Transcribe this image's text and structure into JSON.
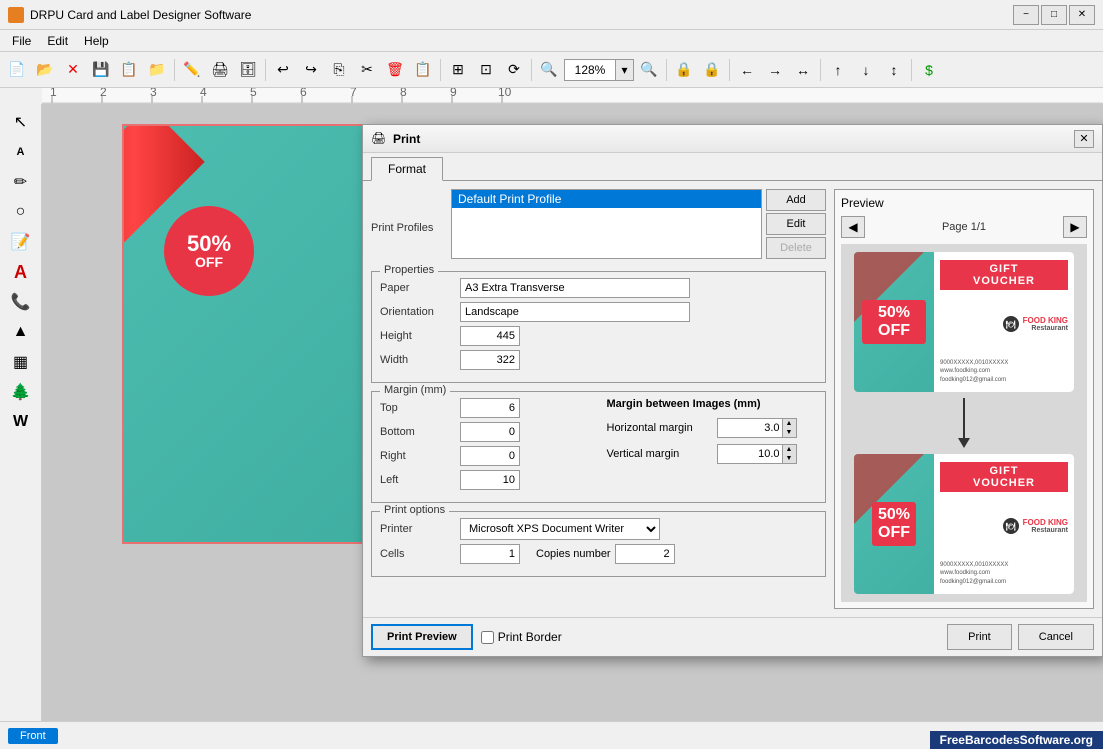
{
  "app": {
    "title": "DRPU Card and Label Designer Software",
    "icon": "🖨"
  },
  "titlebar": {
    "minimize": "−",
    "maximize": "□",
    "close": "✕"
  },
  "menu": {
    "items": [
      "File",
      "Edit",
      "Help"
    ]
  },
  "toolbar": {
    "zoom_value": "128%"
  },
  "dialog": {
    "title": "Print",
    "icon": "🖨",
    "close": "✕",
    "tabs": [
      "Format"
    ],
    "active_tab": "Format",
    "sections": {
      "print_profiles": {
        "label": "Print Profiles",
        "items": [
          "Default Print Profile"
        ],
        "selected": "Default Print Profile",
        "buttons": [
          "Add",
          "Edit",
          "Delete"
        ]
      },
      "properties": {
        "group_title": "Properties",
        "paper_label": "Paper",
        "paper_value": "A3 Extra Transverse",
        "orientation_label": "Orientation",
        "orientation_value": "Landscape",
        "height_label": "Height",
        "height_value": "445",
        "width_label": "Width",
        "width_value": "322"
      },
      "margin": {
        "group_title": "Margin (mm)",
        "top_label": "Top",
        "top_value": "6",
        "bottom_label": "Bottom",
        "bottom_value": "0",
        "right_label": "Right",
        "right_value": "0",
        "left_label": "Left",
        "left_value": "10",
        "between_label": "Margin between Images (mm)",
        "horizontal_label": "Horizontal margin",
        "horizontal_value": "3.0",
        "vertical_label": "Vertical margin",
        "vertical_value": "10.0"
      },
      "print_options": {
        "group_title": "Print options",
        "printer_label": "Printer",
        "printer_value": "Microsoft XPS Document Writer",
        "cells_label": "Cells",
        "cells_value": "1",
        "copies_label": "Copies number",
        "copies_value": "2"
      }
    },
    "preview": {
      "title": "Preview",
      "page_label": "Page 1/1",
      "cards": [
        {
          "percent": "50%\nOFF",
          "title": "GIFT\nVOUCHER",
          "brand": "FOOD KING\nRestaurant"
        },
        {
          "percent": "50%\nOFF",
          "title": "GIFT\nVOUCHER",
          "brand": "FOOD KING\nRestaurant"
        }
      ]
    },
    "footer": {
      "preview_btn": "Print Preview",
      "print_border": "Print Border",
      "print_btn": "Print",
      "cancel_btn": "Cancel"
    }
  },
  "statusbar": {
    "tab": "Front"
  },
  "watermark": "FreeBarcodesSoftware.org"
}
